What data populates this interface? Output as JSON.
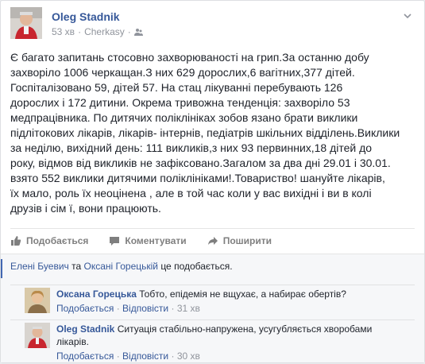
{
  "post": {
    "author": "Oleg Stadnik",
    "time": "53 хв",
    "location": "Cherkasy",
    "text": "Є багато запитань стосовно захворюваності на грип.За останню добу\nзахворіло 1006 черкащан.З них 629 дорослих,6 вагітних,377 дітей.\nГоспіталізовано 59, дітей 57. На стац лікуванні перебувають 126\nдорослих і 172 дитини. Окрема тривожна тенденція: захворіло 53\nмедпрацівника. По дитячих поліклініках зобов язано брати виклики\nпідлітокових лікарів, лікарів- інтернів, педіатрів шкільних відділень.Виклики\nза неділю, вихідний день: 111 викликів,з них 93 первинних,18 дітей до\nроку, відмов від викликів не зафіксовано.Загалом за два дні 29.01 і 30.01.\nвзято 552 виклики дитячими поліклініками!.Товариство! шануйте лікарів,\nїх мало, роль їх неоцінена , але в той час коли у вас вихідні і ви в колі\nдрузів і сім ї, вони працюють.",
    "icons": {
      "privacy": "friends-icon",
      "menu": "chevron-down-icon"
    }
  },
  "actions": {
    "like": "Подобається",
    "comment": "Коментувати",
    "share": "Поширити"
  },
  "likes": {
    "name1": "Елені Буевич",
    "conj": " та ",
    "name2": "Оксані Горецькій",
    "suffix": " це подобається."
  },
  "comments": [
    {
      "author": "Оксана Горецька",
      "text": "Тобто, епідемія не вщухає, а набирає обертів?",
      "like": "Подобається",
      "dot": "·",
      "reply": "Відповісти",
      "time": "31 хв"
    },
    {
      "author": "Oleg Stadnik",
      "text": "Ситуація стабільно-напружена, усугубляється хворобами\nлікарів.",
      "like": "Подобається",
      "dot": "·",
      "reply": "Відповісти",
      "time": "30 хв"
    }
  ],
  "meta_sep": "·",
  "colors": {
    "link": "#365899",
    "meta": "#90949c",
    "accent": "#4267b2"
  }
}
